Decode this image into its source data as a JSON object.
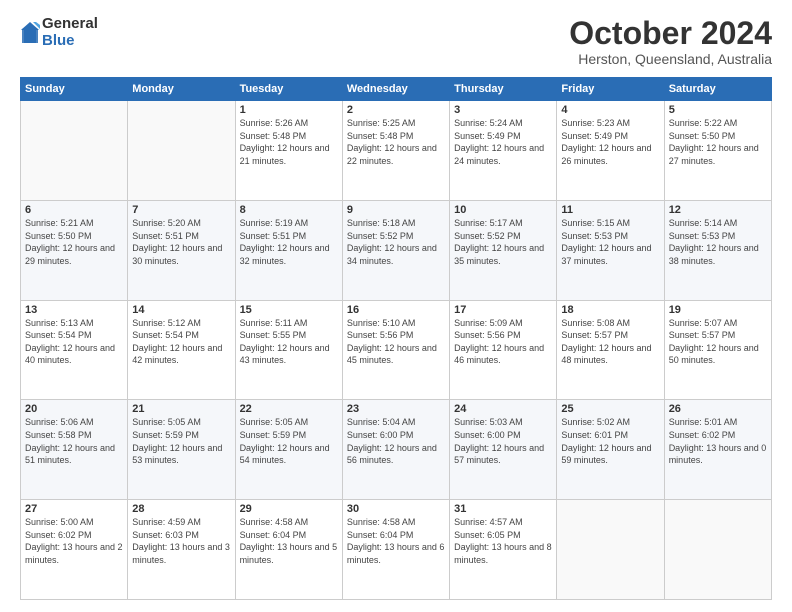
{
  "logo": {
    "general": "General",
    "blue": "Blue"
  },
  "header": {
    "month": "October 2024",
    "location": "Herston, Queensland, Australia"
  },
  "days_of_week": [
    "Sunday",
    "Monday",
    "Tuesday",
    "Wednesday",
    "Thursday",
    "Friday",
    "Saturday"
  ],
  "weeks": [
    [
      {
        "day": "",
        "info": ""
      },
      {
        "day": "",
        "info": ""
      },
      {
        "day": "1",
        "info": "Sunrise: 5:26 AM\nSunset: 5:48 PM\nDaylight: 12 hours and 21 minutes."
      },
      {
        "day": "2",
        "info": "Sunrise: 5:25 AM\nSunset: 5:48 PM\nDaylight: 12 hours and 22 minutes."
      },
      {
        "day": "3",
        "info": "Sunrise: 5:24 AM\nSunset: 5:49 PM\nDaylight: 12 hours and 24 minutes."
      },
      {
        "day": "4",
        "info": "Sunrise: 5:23 AM\nSunset: 5:49 PM\nDaylight: 12 hours and 26 minutes."
      },
      {
        "day": "5",
        "info": "Sunrise: 5:22 AM\nSunset: 5:50 PM\nDaylight: 12 hours and 27 minutes."
      }
    ],
    [
      {
        "day": "6",
        "info": "Sunrise: 5:21 AM\nSunset: 5:50 PM\nDaylight: 12 hours and 29 minutes."
      },
      {
        "day": "7",
        "info": "Sunrise: 5:20 AM\nSunset: 5:51 PM\nDaylight: 12 hours and 30 minutes."
      },
      {
        "day": "8",
        "info": "Sunrise: 5:19 AM\nSunset: 5:51 PM\nDaylight: 12 hours and 32 minutes."
      },
      {
        "day": "9",
        "info": "Sunrise: 5:18 AM\nSunset: 5:52 PM\nDaylight: 12 hours and 34 minutes."
      },
      {
        "day": "10",
        "info": "Sunrise: 5:17 AM\nSunset: 5:52 PM\nDaylight: 12 hours and 35 minutes."
      },
      {
        "day": "11",
        "info": "Sunrise: 5:15 AM\nSunset: 5:53 PM\nDaylight: 12 hours and 37 minutes."
      },
      {
        "day": "12",
        "info": "Sunrise: 5:14 AM\nSunset: 5:53 PM\nDaylight: 12 hours and 38 minutes."
      }
    ],
    [
      {
        "day": "13",
        "info": "Sunrise: 5:13 AM\nSunset: 5:54 PM\nDaylight: 12 hours and 40 minutes."
      },
      {
        "day": "14",
        "info": "Sunrise: 5:12 AM\nSunset: 5:54 PM\nDaylight: 12 hours and 42 minutes."
      },
      {
        "day": "15",
        "info": "Sunrise: 5:11 AM\nSunset: 5:55 PM\nDaylight: 12 hours and 43 minutes."
      },
      {
        "day": "16",
        "info": "Sunrise: 5:10 AM\nSunset: 5:56 PM\nDaylight: 12 hours and 45 minutes."
      },
      {
        "day": "17",
        "info": "Sunrise: 5:09 AM\nSunset: 5:56 PM\nDaylight: 12 hours and 46 minutes."
      },
      {
        "day": "18",
        "info": "Sunrise: 5:08 AM\nSunset: 5:57 PM\nDaylight: 12 hours and 48 minutes."
      },
      {
        "day": "19",
        "info": "Sunrise: 5:07 AM\nSunset: 5:57 PM\nDaylight: 12 hours and 50 minutes."
      }
    ],
    [
      {
        "day": "20",
        "info": "Sunrise: 5:06 AM\nSunset: 5:58 PM\nDaylight: 12 hours and 51 minutes."
      },
      {
        "day": "21",
        "info": "Sunrise: 5:05 AM\nSunset: 5:59 PM\nDaylight: 12 hours and 53 minutes."
      },
      {
        "day": "22",
        "info": "Sunrise: 5:05 AM\nSunset: 5:59 PM\nDaylight: 12 hours and 54 minutes."
      },
      {
        "day": "23",
        "info": "Sunrise: 5:04 AM\nSunset: 6:00 PM\nDaylight: 12 hours and 56 minutes."
      },
      {
        "day": "24",
        "info": "Sunrise: 5:03 AM\nSunset: 6:00 PM\nDaylight: 12 hours and 57 minutes."
      },
      {
        "day": "25",
        "info": "Sunrise: 5:02 AM\nSunset: 6:01 PM\nDaylight: 12 hours and 59 minutes."
      },
      {
        "day": "26",
        "info": "Sunrise: 5:01 AM\nSunset: 6:02 PM\nDaylight: 13 hours and 0 minutes."
      }
    ],
    [
      {
        "day": "27",
        "info": "Sunrise: 5:00 AM\nSunset: 6:02 PM\nDaylight: 13 hours and 2 minutes."
      },
      {
        "day": "28",
        "info": "Sunrise: 4:59 AM\nSunset: 6:03 PM\nDaylight: 13 hours and 3 minutes."
      },
      {
        "day": "29",
        "info": "Sunrise: 4:58 AM\nSunset: 6:04 PM\nDaylight: 13 hours and 5 minutes."
      },
      {
        "day": "30",
        "info": "Sunrise: 4:58 AM\nSunset: 6:04 PM\nDaylight: 13 hours and 6 minutes."
      },
      {
        "day": "31",
        "info": "Sunrise: 4:57 AM\nSunset: 6:05 PM\nDaylight: 13 hours and 8 minutes."
      },
      {
        "day": "",
        "info": ""
      },
      {
        "day": "",
        "info": ""
      }
    ]
  ]
}
